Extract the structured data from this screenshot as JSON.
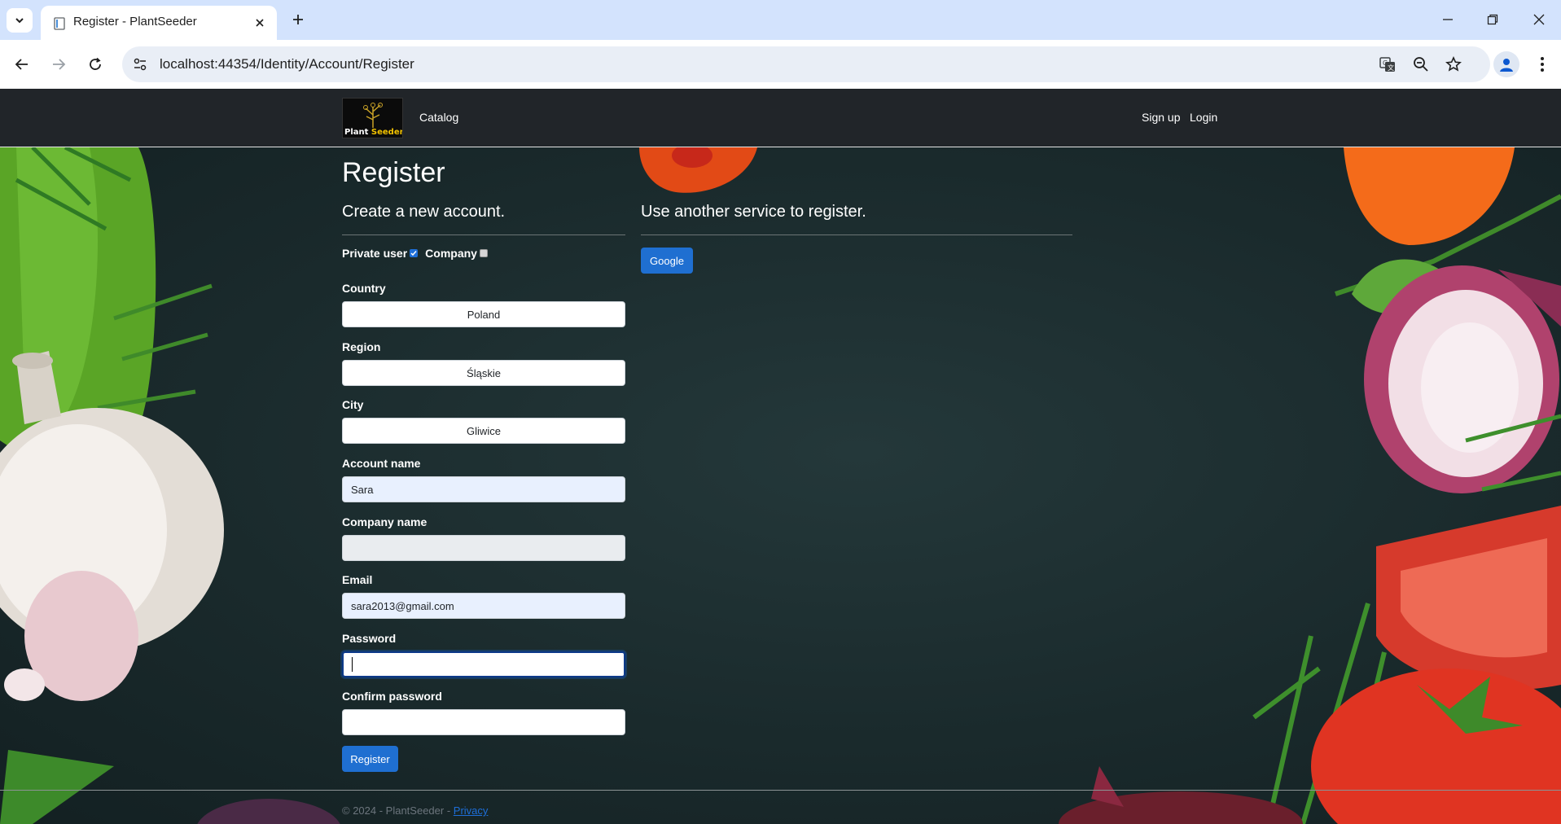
{
  "browser": {
    "tab_title": "Register - PlantSeeder",
    "url": "localhost:44354/Identity/Account/Register"
  },
  "nav": {
    "logo_text_1": "Plant",
    "logo_text_2": "Seeder",
    "catalog": "Catalog",
    "sign_up": "Sign up",
    "login": "Login"
  },
  "page": {
    "title": "Register",
    "subtitle": "Create a new account.",
    "external_title": "Use another service to register.",
    "google_button": "Google"
  },
  "form": {
    "private_user_label": "Private user",
    "private_user_checked": true,
    "company_label": "Company",
    "company_checked": false,
    "country_label": "Country",
    "country_value": "Poland",
    "region_label": "Region",
    "region_value": "Śląskie",
    "city_label": "City",
    "city_value": "Gliwice",
    "account_name_label": "Account name",
    "account_name_value": "Sara",
    "company_name_label": "Company name",
    "company_name_value": "",
    "email_label": "Email",
    "email_value": "sara2013@gmail.com",
    "password_label": "Password",
    "password_value": "",
    "confirm_password_label": "Confirm password",
    "confirm_password_value": "",
    "register_button": "Register"
  },
  "footer": {
    "text": "© 2024 - PlantSeeder -",
    "privacy": "Privacy"
  },
  "colors": {
    "navbar": "#212529",
    "primary_button": "#1f6fd1",
    "tabstrip": "#d3e3fd"
  }
}
